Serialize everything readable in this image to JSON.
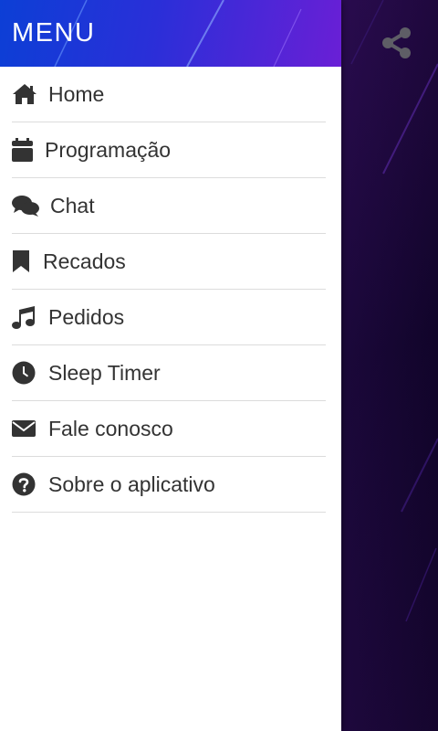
{
  "drawer": {
    "title": "MENU",
    "items": [
      {
        "label": "Home",
        "icon": "home-icon"
      },
      {
        "label": "Programação",
        "icon": "calendar-icon"
      },
      {
        "label": "Chat",
        "icon": "chat-bubbles-icon"
      },
      {
        "label": "Recados",
        "icon": "bookmark-icon"
      },
      {
        "label": "Pedidos",
        "icon": "music-note-icon"
      },
      {
        "label": "Sleep Timer",
        "icon": "clock-icon"
      },
      {
        "label": "Fale conosco",
        "icon": "envelope-icon"
      },
      {
        "label": "Sobre o aplicativo",
        "icon": "question-circle-icon"
      }
    ]
  },
  "toolbar": {
    "share_icon": "share-icon"
  },
  "colors": {
    "header_start": "#0c3fd6",
    "header_end": "#6a1fd6",
    "background": "#0b0220",
    "icon": "#333333",
    "text": "#333333",
    "divider": "#dcdcdc"
  }
}
